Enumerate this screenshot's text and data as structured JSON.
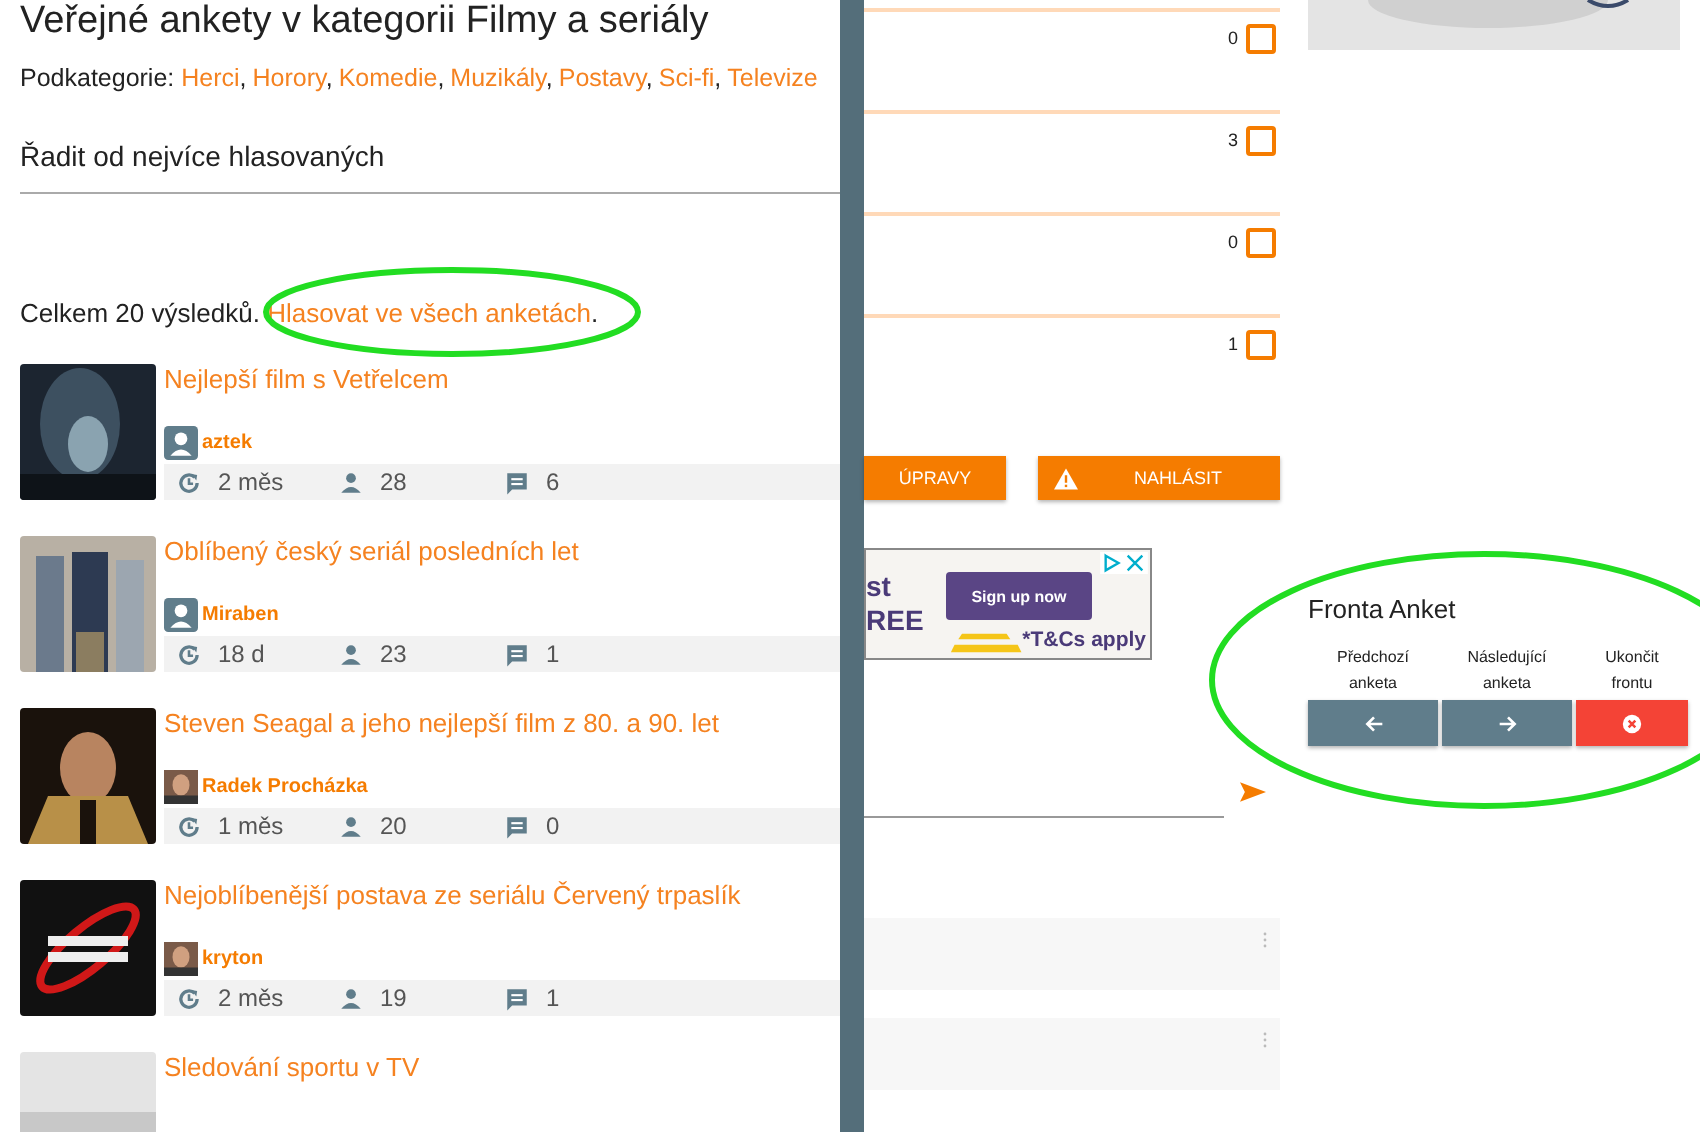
{
  "page_title": "Veřejné ankety v kategorii Filmy a seriály",
  "subcategories": {
    "label": "Podkategorie:",
    "separator": ",",
    "items": [
      "Herci",
      "Horory",
      "Komedie",
      "Muzikály",
      "Postavy",
      "Sci-fi",
      "Televize"
    ]
  },
  "sort": "Řadit od nejvíce hlasovaných",
  "results": {
    "prefix": "Celkem 20 výsledků.",
    "link": "Hlasovat ve všech anketách",
    "suffix": "."
  },
  "polls": [
    {
      "title": "Nejlepší film s Vetřelcem",
      "author": "aztek",
      "avatar": {
        "kind": "icon"
      },
      "age": "2 měs",
      "votes": "28",
      "comments": "6"
    },
    {
      "title": "Oblíbený český seriál posledních let",
      "author": "Miraben",
      "avatar": {
        "kind": "icon"
      },
      "age": "18 d",
      "votes": "23",
      "comments": "1"
    },
    {
      "title": "Steven Seagal a jeho nejlepší film z 80. a 90. let",
      "author": "Radek Procházka",
      "age": "1 měs",
      "votes": "20",
      "comments": "0"
    },
    {
      "title": "Nejoblíbenější postava ze seriálu Červený trpaslík",
      "author": "kryton",
      "age": "2 měs",
      "votes": "19",
      "comments": "1"
    },
    {
      "title": "Sledování sportu v TV"
    }
  ],
  "answers": [
    {
      "count": "0",
      "checked": false
    },
    {
      "count": "3",
      "checked": false
    },
    {
      "count": "0",
      "checked": false
    },
    {
      "count": "1",
      "checked": false
    }
  ],
  "actions": [
    {
      "label": "ÚPRAVY",
      "kind": "plain"
    },
    {
      "label": "NAHLÁSIT",
      "kind": "warning"
    }
  ],
  "ad": {
    "headline_1": "st",
    "headline_2": "REE",
    "button": "Sign up now",
    "note": "*T&Cs apply"
  },
  "queue": {
    "title": "Fronta Anket",
    "buttons": [
      {
        "label": "Předchozí anketa",
        "kind": "previous"
      },
      {
        "label": "Následující anketa",
        "kind": "next"
      },
      {
        "label": "Ukončit frontu",
        "kind": "close"
      }
    ]
  }
}
